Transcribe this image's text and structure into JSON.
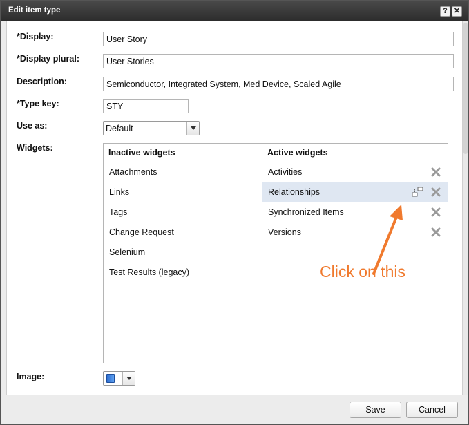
{
  "dialog": {
    "title": "Edit item type",
    "help_label": "?",
    "close_label": "✕"
  },
  "form": {
    "display_label": "*Display:",
    "display_value": "User Story",
    "plural_label": "*Display plural:",
    "plural_value": "User Stories",
    "description_label": "Description:",
    "description_value": "Semiconductor, Integrated System, Med Device, Scaled Agile",
    "typekey_label": "*Type key:",
    "typekey_value": "STY",
    "useas_label": "Use as:",
    "useas_value": "Default",
    "widgets_label": "Widgets:",
    "image_label": "Image:"
  },
  "widgets": {
    "inactive_header": "Inactive widgets",
    "active_header": "Active widgets",
    "inactive": [
      "Attachments",
      "Links",
      "Tags",
      "Change Request",
      "Selenium",
      "Test Results (legacy)"
    ],
    "active": [
      "Activities",
      "Relationships",
      "Synchronized Items",
      "Versions"
    ]
  },
  "annotation": {
    "text": "Click on this",
    "color": "#f07a2e"
  },
  "footer": {
    "save_label": "Save",
    "cancel_label": "Cancel"
  }
}
